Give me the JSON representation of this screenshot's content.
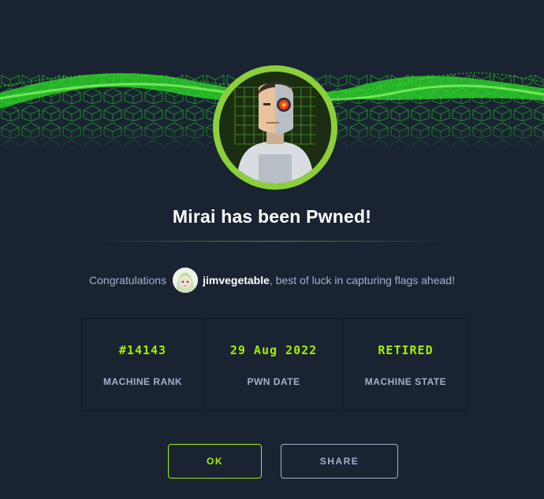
{
  "modal": {
    "title": "Mirai has been Pwned!",
    "congrats_prefix": "Congratulations",
    "username": "jimvegetable",
    "congrats_suffix": ", best of luck in capturing flags ahead!"
  },
  "stats": [
    {
      "value": "#14143",
      "label": "MACHINE RANK"
    },
    {
      "value": "29 Aug 2022",
      "label": "PWN DATE"
    },
    {
      "value": "RETIRED",
      "label": "MACHINE STATE"
    }
  ],
  "buttons": {
    "ok_label": "OK",
    "share_label": "SHARE"
  },
  "colors": {
    "accent": "#9fef00",
    "background": "#1a2332",
    "text_muted": "#a4b1cd"
  },
  "icons": {
    "banner": "green-cube-grid-banner",
    "machine": "cyborg-machine-avatar",
    "user": "anime-user-avatar"
  }
}
